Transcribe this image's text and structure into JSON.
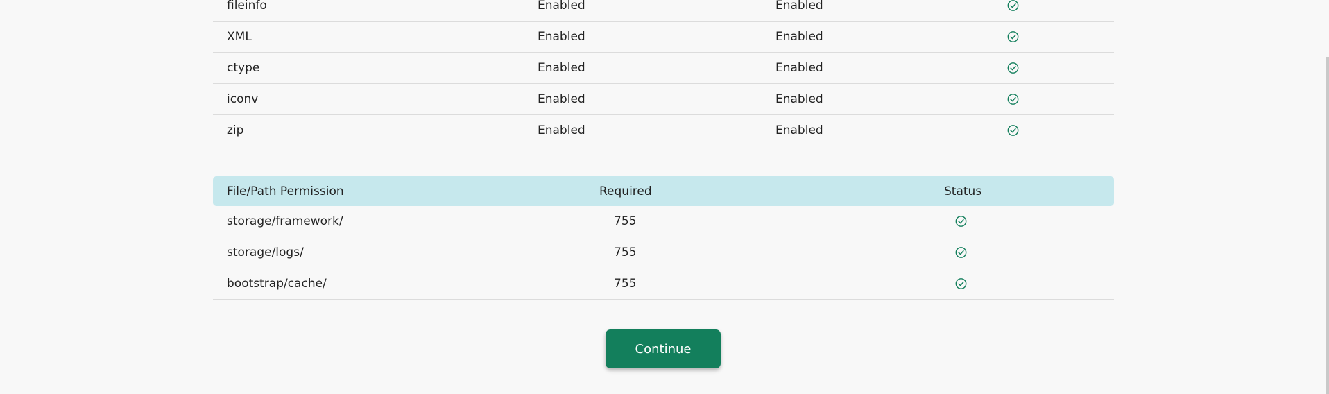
{
  "extensions": {
    "rows": [
      {
        "name": "fileinfo",
        "required": "Enabled",
        "current": "Enabled",
        "status_icon": "check-circle-icon"
      },
      {
        "name": "XML",
        "required": "Enabled",
        "current": "Enabled",
        "status_icon": "check-circle-icon"
      },
      {
        "name": "ctype",
        "required": "Enabled",
        "current": "Enabled",
        "status_icon": "check-circle-icon"
      },
      {
        "name": "iconv",
        "required": "Enabled",
        "current": "Enabled",
        "status_icon": "check-circle-icon"
      },
      {
        "name": "zip",
        "required": "Enabled",
        "current": "Enabled",
        "status_icon": "check-circle-icon"
      }
    ]
  },
  "permissions": {
    "headers": {
      "name": "File/Path Permission",
      "required": "Required",
      "status": "Status"
    },
    "rows": [
      {
        "path": "storage/framework/",
        "required": "755",
        "status_icon": "check-circle-icon"
      },
      {
        "path": "storage/logs/",
        "required": "755",
        "status_icon": "check-circle-icon"
      },
      {
        "path": "bootstrap/cache/",
        "required": "755",
        "status_icon": "check-circle-icon"
      }
    ]
  },
  "actions": {
    "continue_label": "Continue"
  },
  "colors": {
    "header_bg": "#c6e8ed",
    "button_bg": "#137f5c",
    "check_color": "#137f5c",
    "page_bg": "#f8f8f8"
  }
}
